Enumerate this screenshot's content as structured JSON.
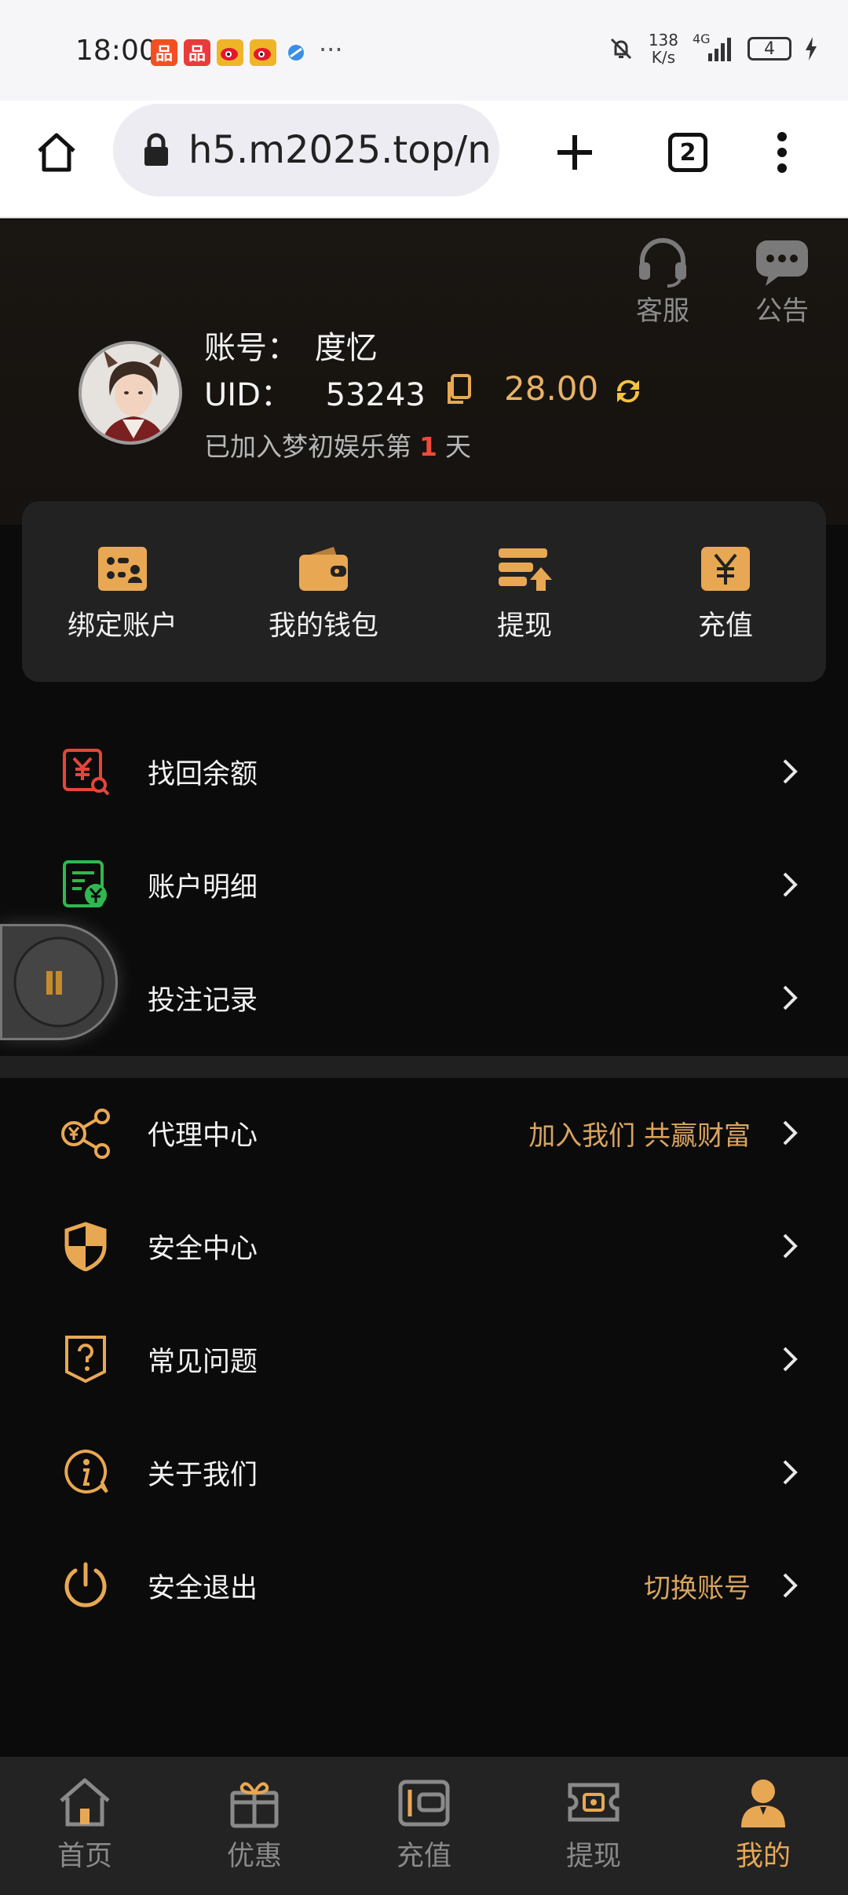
{
  "status_bar": {
    "time": "18:00",
    "more": "···",
    "net_speed_value": "138",
    "net_speed_unit": "K/s",
    "network": "4G",
    "battery": "4"
  },
  "browser": {
    "url": "h5.m2025.top/n",
    "tab_count": "2"
  },
  "header": {
    "service_label": "客服",
    "notice_label": "公告",
    "account_label": "账号：",
    "account_name": "度忆",
    "uid_label": "UID：",
    "uid_value": "53243",
    "balance": "28.00",
    "joined_prefix": "已加入梦初娱乐第",
    "joined_days": "1",
    "joined_suffix": "天"
  },
  "quick_actions": [
    {
      "label": "绑定账户"
    },
    {
      "label": "我的钱包"
    },
    {
      "label": "提现"
    },
    {
      "label": "充值"
    }
  ],
  "menu_group_1": [
    {
      "label": "找回余额"
    },
    {
      "label": "账户明细"
    },
    {
      "label": "投注记录"
    }
  ],
  "menu_group_2": [
    {
      "label": "代理中心",
      "extra": "加入我们 共赢财富"
    },
    {
      "label": "安全中心"
    },
    {
      "label": "常见问题"
    },
    {
      "label": "关于我们"
    },
    {
      "label": "安全退出",
      "extra": "切换账号"
    }
  ],
  "bottom_nav": [
    {
      "label": "首页"
    },
    {
      "label": "优惠"
    },
    {
      "label": "充值"
    },
    {
      "label": "提现"
    },
    {
      "label": "我的",
      "active": true
    }
  ],
  "colors": {
    "accent": "#E8A853",
    "background": "#0B0B0B",
    "card": "#222222",
    "highlight_red": "#EF4B3A"
  }
}
